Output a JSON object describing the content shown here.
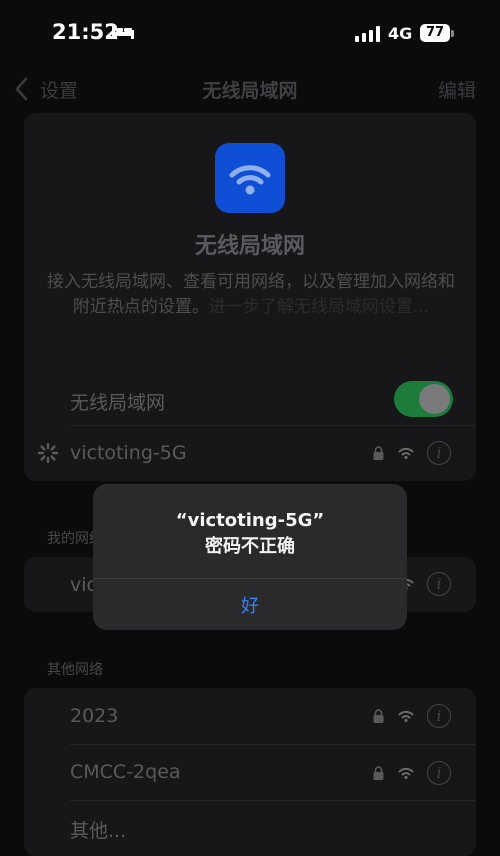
{
  "status_bar": {
    "time": "21:52",
    "network": "4G",
    "battery": "77"
  },
  "nav": {
    "back_label": "设置",
    "title": "无线局域网",
    "edit_label": "编辑"
  },
  "hero": {
    "title": "无线局域网",
    "description": "接入无线局域网、查看可用网络，以及管理加入网络和附近热点的设置。",
    "learn_more": "进一步了解无线局域网设置..."
  },
  "wifi_toggle": {
    "label": "无线局域网",
    "on": true
  },
  "current_network": {
    "name": "victoting-5G"
  },
  "my_networks": {
    "header": "我的网络",
    "items": [
      {
        "name": "victoting-5G"
      }
    ]
  },
  "other_networks": {
    "header": "其他网络",
    "items": [
      {
        "name": "2023"
      },
      {
        "name": "CMCC-2qea"
      }
    ],
    "other_label": "其他..."
  },
  "alert": {
    "title_line1": "“victoting-5G”",
    "title_line2": "密码不正确",
    "ok_label": "好"
  },
  "colors": {
    "accent": "#3a82f7",
    "toggle_on": "#1c7d3a",
    "app_icon": "#0f4fd6"
  }
}
